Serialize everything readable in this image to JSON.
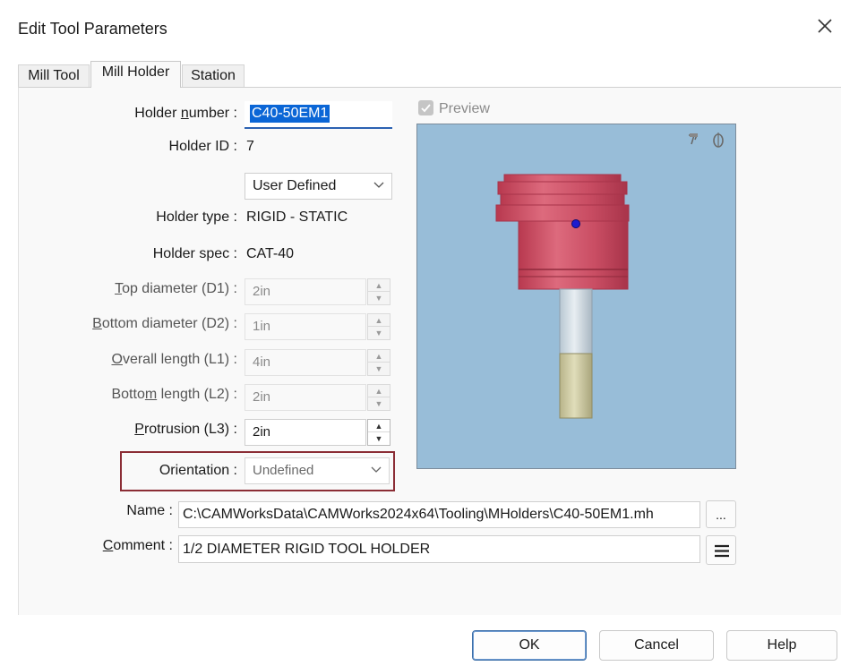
{
  "dialog": {
    "title": "Edit Tool Parameters"
  },
  "tabs": [
    {
      "label": "Mill Tool",
      "active": false
    },
    {
      "label": "Mill Holder",
      "active": true
    },
    {
      "label": "Station",
      "active": false
    }
  ],
  "form": {
    "holder_number": {
      "label_pre": "Holder ",
      "label_u": "n",
      "label_post": "umber :",
      "value": "C40-50EM1"
    },
    "holder_id": {
      "label": "Holder ID :",
      "value": "7"
    },
    "holder_source": {
      "value": "User Defined"
    },
    "holder_type": {
      "label": "Holder type :",
      "value": "RIGID - STATIC"
    },
    "holder_spec": {
      "label": "Holder spec :",
      "value": "CAT-40"
    },
    "top_diameter": {
      "label_u": "T",
      "label_post": "op diameter (D1) :",
      "value": "2in"
    },
    "bottom_diameter": {
      "label_u": "B",
      "label_post": "ottom diameter (D2) :",
      "value": "1in"
    },
    "overall_length": {
      "label_u": "O",
      "label_post": "verall length (L1) :",
      "value": "4in"
    },
    "bottom_length": {
      "label_pre": "Botto",
      "label_u": "m",
      "label_post": " length (L2) :",
      "value": "2in"
    },
    "protrusion": {
      "label_u": "P",
      "label_post": "rotrusion (L3) :",
      "value": "2in"
    },
    "orientation": {
      "label": "Orientation :",
      "value": "Undefined"
    },
    "name": {
      "label": "Name :",
      "value": "C:\\CAMWorksData\\CAMWorks2024x64\\Tooling\\MHolders\\C40-50EM1.mh",
      "browse": "..."
    },
    "comment": {
      "label_u": "C",
      "label_post": "omment :",
      "value": "1/2 DIAMETER RIGID TOOL HOLDER"
    }
  },
  "preview": {
    "label": "Preview",
    "checked": true
  },
  "buttons": {
    "ok": "OK",
    "cancel": "Cancel",
    "help": "Help"
  },
  "colors": {
    "highlight_border": "#8b2d35",
    "preview_bg": "#98bdd8",
    "holder_body": "#c94d63",
    "selection": "#3a78d4"
  }
}
